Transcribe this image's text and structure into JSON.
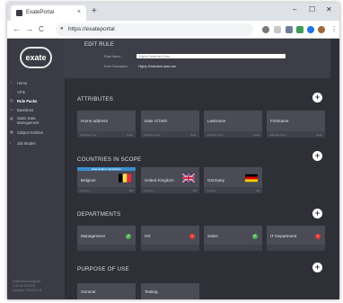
{
  "browser": {
    "tab_title": "ExatePortal",
    "tab_close": "×",
    "new_tab": "+",
    "minimize": "–",
    "maximize": "☐",
    "close": "✕",
    "back": "←",
    "forward": "→",
    "reload": "C",
    "url": "https://exateportal",
    "menu": "⋮"
  },
  "sidebar": {
    "logo": "exate",
    "items": [
      {
        "label": "Home",
        "icon": "home-icon",
        "glyph": "⌂"
      },
      {
        "label": "APIs",
        "icon": "api-icon",
        "glyph": "◦"
      },
      {
        "label": "Rule Packs",
        "icon": "rules-icon",
        "glyph": "▤",
        "active": true
      },
      {
        "label": "Baselines",
        "icon": "baseline-icon",
        "glyph": "▭"
      },
      {
        "label": "Static Data Management",
        "icon": "data-icon",
        "glyph": "▦"
      },
      {
        "label": "Subject Entities",
        "icon": "entities-icon",
        "glyph": "▣"
      },
      {
        "label": "Job Modes",
        "icon": "job-icon",
        "glyph": "▪"
      }
    ],
    "footer_line1": "exate technology ltd",
    "footer_line2": "V.00.00.00.0000",
    "footer_line3": "Updated: 2019-01-11"
  },
  "edit_rule": {
    "title": "EDIT RULE",
    "name_label": "Rule Name:",
    "name_value": "Highly Restricted Data",
    "desc_label": "Rule Description:",
    "desc_value": "Highly Restricted data rule"
  },
  "attributes": {
    "title": "ATTRIBUTES",
    "add": "+",
    "cards": [
      {
        "name": "Home address",
        "foot_left": "Attribute Type",
        "foot_right": "Hash"
      },
      {
        "name": "Date of birth",
        "foot_left": "Attribute Type",
        "foot_right": "Hash"
      },
      {
        "name": "Lastname",
        "foot_left": "Attribute Type",
        "foot_right": "Hash"
      },
      {
        "name": "Firstname",
        "foot_left": "Attribute Type",
        "foot_right": "Hash"
      }
    ]
  },
  "countries": {
    "title": "COUNTRIES IN SCOPE",
    "add": "+",
    "cards": [
      {
        "name": "Belgium",
        "badge": "Data Subject Jurisdiction",
        "flag": "belgium",
        "foot_left": "Country",
        "foot_right": "BE"
      },
      {
        "name": "United Kingdom",
        "badge": "",
        "flag": "uk",
        "foot_left": "Country",
        "foot_right": "GB"
      },
      {
        "name": "Germany",
        "badge": "",
        "flag": "germany",
        "foot_left": "Country",
        "foot_right": "DE"
      }
    ]
  },
  "departments": {
    "title": "DEPARTMENTS",
    "add": "+",
    "cards": [
      {
        "name": "Management",
        "status": "allowed",
        "glyph": "✓",
        "color": "#4caf50"
      },
      {
        "name": "HR",
        "status": "denied",
        "glyph": "–",
        "color": "#e53935"
      },
      {
        "name": "Sales",
        "status": "allowed",
        "glyph": "✓",
        "color": "#4caf50"
      },
      {
        "name": "IT Department",
        "status": "denied",
        "glyph": "–",
        "color": "#e53935"
      }
    ]
  },
  "purpose": {
    "title": "PURPOSE OF USE",
    "add": "+",
    "cards": [
      {
        "name": "General"
      },
      {
        "name": "Testing"
      }
    ]
  },
  "colors": {
    "background": "#2f3037",
    "sidebar": "#3a3b44",
    "card": "#4a4b55",
    "badge": "#3a8fd0",
    "allowed": "#4caf50",
    "denied": "#e53935"
  }
}
